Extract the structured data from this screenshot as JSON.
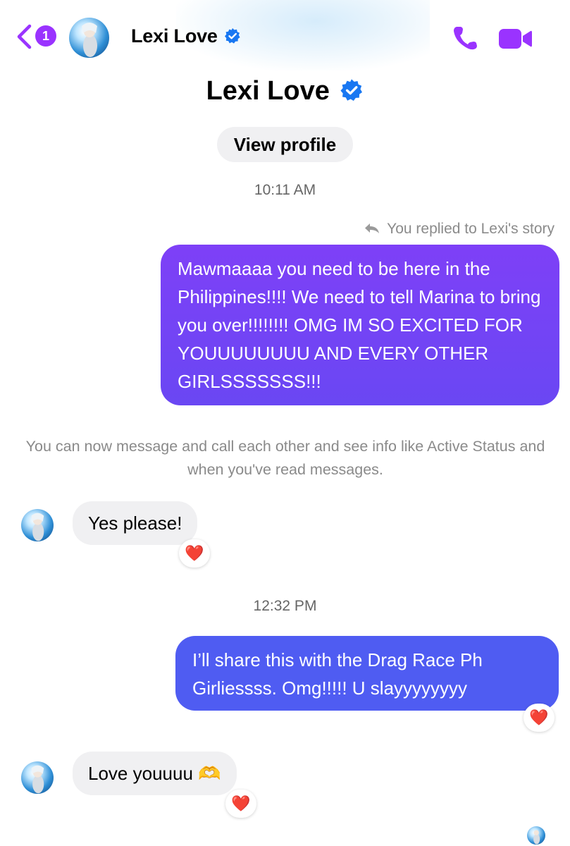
{
  "header": {
    "unread_count": "1",
    "contact_name": "Lexi Love"
  },
  "profile": {
    "name": "Lexi Love",
    "view_profile_label": "View profile"
  },
  "conversation": {
    "time_1": "10:11 AM",
    "story_reply_note": "You replied to Lexi's story",
    "msg_out_1": "Mawmaaaa you need to be here in the Philippines!!!! We need to tell Marina to bring you over!!!!!!!! OMG IM SO EXCITED FOR YOUUUUUUUU AND EVERY OTHER GIRLSSSSSSS!!!",
    "system_notice": "You can now message and call each other and see info like Active Status and when you've read messages.",
    "msg_in_1": "Yes please!",
    "time_2": "12:32 PM",
    "msg_out_2": "I’ll share this with the Drag Race Ph Girliessss. Omg!!!!! U slayyyyyyyy",
    "msg_in_2": "Love youuuu 🫶",
    "reaction": "❤️"
  },
  "colors": {
    "accent": "#9a33ff",
    "bubble_purple": "#7a42f6",
    "bubble_blue": "#4f5cf2",
    "incoming_bubble": "#f0f0f2",
    "verified_blue": "#1877f2",
    "heart_red": "#e21b3c"
  },
  "icons": [
    "back-chevron-icon",
    "verified-badge-icon",
    "phone-icon",
    "video-camera-icon",
    "reply-arrow-icon",
    "heart-icon"
  ]
}
